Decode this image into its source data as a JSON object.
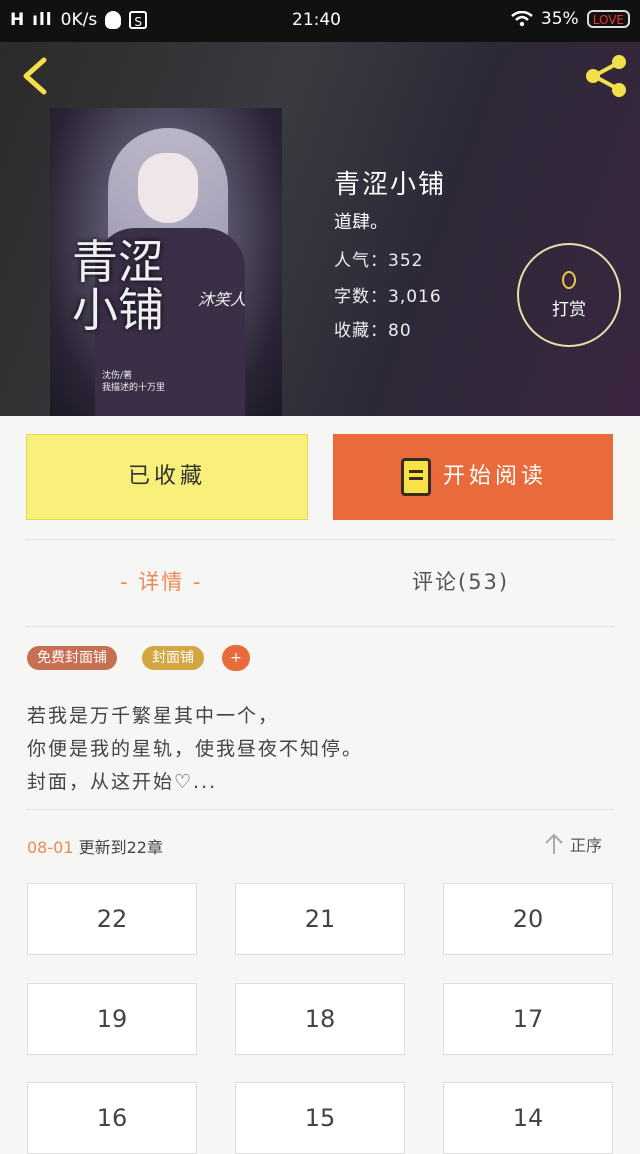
{
  "status_bar": {
    "signal": "H ıll",
    "speed": "0K/s",
    "time": "21:40",
    "battery_percent": "35%",
    "battery_label": "LOVE"
  },
  "book": {
    "title": "青涩小铺",
    "author": "道肆。",
    "popularity": "人气：352",
    "word_count": "字数：3,016",
    "favorites": "收藏：80",
    "cover_title": "青涩小铺",
    "cover_subtitle_1": "沈伤/著",
    "cover_subtitle_2": "我描述的十万里",
    "cover_signature": "沐笑人"
  },
  "tip": {
    "label": "打赏"
  },
  "buttons": {
    "favorited": "已收藏",
    "start_reading": "开始阅读"
  },
  "tabs": [
    {
      "label": "- 详情 -",
      "active": true
    },
    {
      "label": "评论(53)",
      "active": false
    }
  ],
  "tags": [
    "免费封面铺",
    "封面铺",
    "+"
  ],
  "description": [
    "若我是万千繁星其中一个，",
    "你便是我的星轨，使我昼夜不知停。",
    "封面，从这开始♡..."
  ],
  "update": {
    "date": "08-01",
    "text": "更新到22章"
  },
  "order": {
    "label": "正序"
  },
  "chapters": [
    "22",
    "21",
    "20",
    "19",
    "18",
    "17",
    "16",
    "15",
    "14"
  ],
  "colors": {
    "accent_orange": "#e96a3a",
    "fav_yellow": "#f8f07a",
    "tab_active": "#ec8a55"
  }
}
